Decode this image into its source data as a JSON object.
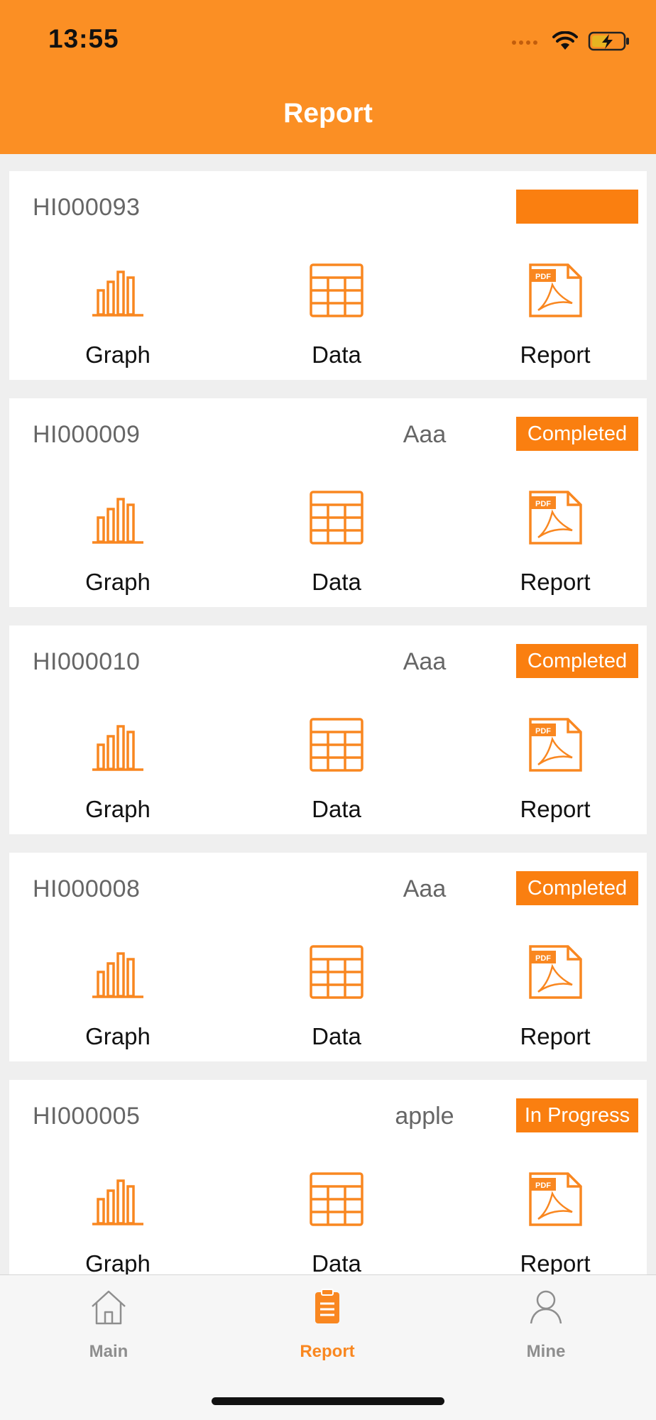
{
  "status_bar": {
    "time": "13:55"
  },
  "header": {
    "title": "Report"
  },
  "actions": {
    "graph_label": "Graph",
    "data_label": "Data",
    "report_label": "Report"
  },
  "cards": [
    {
      "id": "HI000093",
      "name": "",
      "status": ""
    },
    {
      "id": "HI000009",
      "name": "Aaa",
      "status": "Completed"
    },
    {
      "id": "HI000010",
      "name": "Aaa",
      "status": "Completed"
    },
    {
      "id": "HI000008",
      "name": "Aaa",
      "status": "Completed"
    },
    {
      "id": "HI000005",
      "name": "apple",
      "status": "In Progress"
    }
  ],
  "tabbar": {
    "items": [
      {
        "label": "Main",
        "icon": "home-icon",
        "active": false
      },
      {
        "label": "Report",
        "icon": "clipboard-icon",
        "active": true
      },
      {
        "label": "Mine",
        "icon": "person-icon",
        "active": false
      }
    ]
  },
  "colors": {
    "accent": "#fb8f24",
    "badge": "#fa7f10",
    "tab_inactive": "#8e8e8e",
    "tab_active": "#f98720"
  }
}
